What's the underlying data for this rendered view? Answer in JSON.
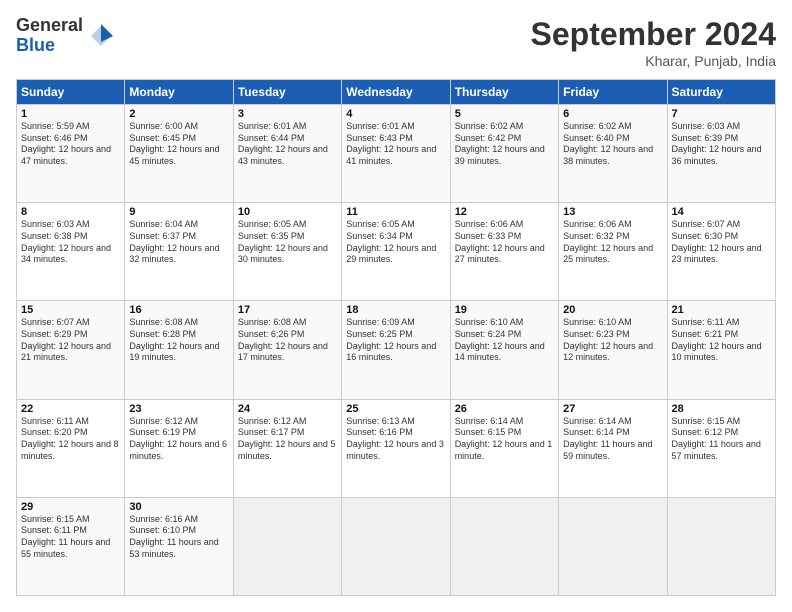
{
  "header": {
    "logo_general": "General",
    "logo_blue": "Blue",
    "title": "September 2024",
    "location": "Kharar, Punjab, India"
  },
  "calendar": {
    "days_of_week": [
      "Sunday",
      "Monday",
      "Tuesday",
      "Wednesday",
      "Thursday",
      "Friday",
      "Saturday"
    ],
    "weeks": [
      [
        null,
        {
          "day": "2",
          "sunrise": "6:00 AM",
          "sunset": "6:45 PM",
          "daylight": "12 hours and 45 minutes."
        },
        {
          "day": "3",
          "sunrise": "6:01 AM",
          "sunset": "6:44 PM",
          "daylight": "12 hours and 43 minutes."
        },
        {
          "day": "4",
          "sunrise": "6:01 AM",
          "sunset": "6:43 PM",
          "daylight": "12 hours and 41 minutes."
        },
        {
          "day": "5",
          "sunrise": "6:02 AM",
          "sunset": "6:42 PM",
          "daylight": "12 hours and 39 minutes."
        },
        {
          "day": "6",
          "sunrise": "6:02 AM",
          "sunset": "6:40 PM",
          "daylight": "12 hours and 38 minutes."
        },
        {
          "day": "7",
          "sunrise": "6:03 AM",
          "sunset": "6:39 PM",
          "daylight": "12 hours and 36 minutes."
        }
      ],
      [
        {
          "day": "1",
          "sunrise": "5:59 AM",
          "sunset": "6:46 PM",
          "daylight": "12 hours and 47 minutes."
        },
        {
          "day": "9",
          "sunrise": "6:04 AM",
          "sunset": "6:37 PM",
          "daylight": "12 hours and 32 minutes."
        },
        {
          "day": "10",
          "sunrise": "6:05 AM",
          "sunset": "6:35 PM",
          "daylight": "12 hours and 30 minutes."
        },
        {
          "day": "11",
          "sunrise": "6:05 AM",
          "sunset": "6:34 PM",
          "daylight": "12 hours and 29 minutes."
        },
        {
          "day": "12",
          "sunrise": "6:06 AM",
          "sunset": "6:33 PM",
          "daylight": "12 hours and 27 minutes."
        },
        {
          "day": "13",
          "sunrise": "6:06 AM",
          "sunset": "6:32 PM",
          "daylight": "12 hours and 25 minutes."
        },
        {
          "day": "14",
          "sunrise": "6:07 AM",
          "sunset": "6:30 PM",
          "daylight": "12 hours and 23 minutes."
        }
      ],
      [
        {
          "day": "8",
          "sunrise": "6:03 AM",
          "sunset": "6:38 PM",
          "daylight": "12 hours and 34 minutes."
        },
        {
          "day": "16",
          "sunrise": "6:08 AM",
          "sunset": "6:28 PM",
          "daylight": "12 hours and 19 minutes."
        },
        {
          "day": "17",
          "sunrise": "6:08 AM",
          "sunset": "6:26 PM",
          "daylight": "12 hours and 17 minutes."
        },
        {
          "day": "18",
          "sunrise": "6:09 AM",
          "sunset": "6:25 PM",
          "daylight": "12 hours and 16 minutes."
        },
        {
          "day": "19",
          "sunrise": "6:10 AM",
          "sunset": "6:24 PM",
          "daylight": "12 hours and 14 minutes."
        },
        {
          "day": "20",
          "sunrise": "6:10 AM",
          "sunset": "6:23 PM",
          "daylight": "12 hours and 12 minutes."
        },
        {
          "day": "21",
          "sunrise": "6:11 AM",
          "sunset": "6:21 PM",
          "daylight": "12 hours and 10 minutes."
        }
      ],
      [
        {
          "day": "15",
          "sunrise": "6:07 AM",
          "sunset": "6:29 PM",
          "daylight": "12 hours and 21 minutes."
        },
        {
          "day": "23",
          "sunrise": "6:12 AM",
          "sunset": "6:19 PM",
          "daylight": "12 hours and 6 minutes."
        },
        {
          "day": "24",
          "sunrise": "6:12 AM",
          "sunset": "6:17 PM",
          "daylight": "12 hours and 5 minutes."
        },
        {
          "day": "25",
          "sunrise": "6:13 AM",
          "sunset": "6:16 PM",
          "daylight": "12 hours and 3 minutes."
        },
        {
          "day": "26",
          "sunrise": "6:14 AM",
          "sunset": "6:15 PM",
          "daylight": "12 hours and 1 minute."
        },
        {
          "day": "27",
          "sunrise": "6:14 AM",
          "sunset": "6:14 PM",
          "daylight": "11 hours and 59 minutes."
        },
        {
          "day": "28",
          "sunrise": "6:15 AM",
          "sunset": "6:12 PM",
          "daylight": "11 hours and 57 minutes."
        }
      ],
      [
        {
          "day": "22",
          "sunrise": "6:11 AM",
          "sunset": "6:20 PM",
          "daylight": "12 hours and 8 minutes."
        },
        {
          "day": "30",
          "sunrise": "6:16 AM",
          "sunset": "6:10 PM",
          "daylight": "11 hours and 53 minutes."
        },
        null,
        null,
        null,
        null,
        null
      ],
      [
        {
          "day": "29",
          "sunrise": "6:15 AM",
          "sunset": "6:11 PM",
          "daylight": "11 hours and 55 minutes."
        },
        null,
        null,
        null,
        null,
        null,
        null
      ]
    ]
  }
}
